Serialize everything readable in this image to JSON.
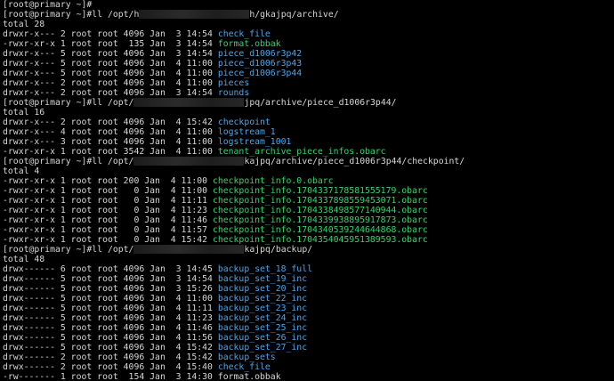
{
  "lines": [
    {
      "kind": "prompt",
      "text": "[root@primary ~]#"
    },
    {
      "kind": "prompt_path",
      "before": "[root@primary ~]#ll /opt/h",
      "after": "h/gkajpq/archive/"
    },
    {
      "kind": "plain",
      "text": "total 28"
    },
    {
      "kind": "entry",
      "meta": "drwxr-x--- 2 root root 4096 Jan  3 14:54 ",
      "name": "check_file",
      "style": "dir"
    },
    {
      "kind": "entry",
      "meta": "-rwxr-xr-x 1 root root  135 Jan  3 14:54 ",
      "name": "format.obbak",
      "style": "exe"
    },
    {
      "kind": "entry",
      "meta": "drwxr-x--- 5 root root 4096 Jan  3 14:54 ",
      "name": "piece_d1006r3p42",
      "style": "dir"
    },
    {
      "kind": "entry",
      "meta": "drwxr-x--- 5 root root 4096 Jan  4 11:00 ",
      "name": "piece_d1006r3p43",
      "style": "dir"
    },
    {
      "kind": "entry",
      "meta": "drwxr-x--- 5 root root 4096 Jan  4 11:00 ",
      "name": "piece_d1006r3p44",
      "style": "dir"
    },
    {
      "kind": "entry",
      "meta": "drwxr-x--- 2 root root 4096 Jan  4 11:00 ",
      "name": "pieces",
      "style": "dir"
    },
    {
      "kind": "entry",
      "meta": "drwxr-x--- 2 root root 4096 Jan  3 14:54 ",
      "name": "rounds",
      "style": "dir"
    },
    {
      "kind": "prompt_path",
      "before": "[root@primary ~]#ll /opt/",
      "after": "jpq/archive/piece_d1006r3p44/"
    },
    {
      "kind": "plain",
      "text": "total 16"
    },
    {
      "kind": "entry",
      "meta": "drwxr-x--- 2 root root 4096 Jan  4 15:42 ",
      "name": "checkpoint",
      "style": "dir"
    },
    {
      "kind": "entry",
      "meta": "drwxr-x--- 4 root root 4096 Jan  4 11:00 ",
      "name": "logstream_1",
      "style": "dir"
    },
    {
      "kind": "entry",
      "meta": "drwxr-x--- 3 root root 4096 Jan  4 11:00 ",
      "name": "logstream_1001",
      "style": "dir"
    },
    {
      "kind": "entry",
      "meta": "-rwxr-xr-x 1 root root 3542 Jan  4 11:00 ",
      "name": "tenant_archive_piece_infos.obarc",
      "style": "exe"
    },
    {
      "kind": "prompt_path",
      "before": "[root@primary ~]#ll /opt/",
      "after": "kajpq/archive/piece_d1006r3p44/checkpoint/"
    },
    {
      "kind": "plain",
      "text": "total 4"
    },
    {
      "kind": "entry",
      "meta": "-rwxr-xr-x 1 root root 200 Jan  4 11:00 ",
      "name": "checkpoint_info.0.obarc",
      "style": "exe"
    },
    {
      "kind": "entry",
      "meta": "-rwxr-xr-x 1 root root   0 Jan  4 11:00 ",
      "name": "checkpoint_info.1704337178581555179.obarc",
      "style": "exe"
    },
    {
      "kind": "entry",
      "meta": "-rwxr-xr-x 1 root root   0 Jan  4 11:11 ",
      "name": "checkpoint_info.1704337898559453071.obarc",
      "style": "exe"
    },
    {
      "kind": "entry",
      "meta": "-rwxr-xr-x 1 root root   0 Jan  4 11:23 ",
      "name": "checkpoint_info.1704338498577140944.obarc",
      "style": "exe"
    },
    {
      "kind": "entry",
      "meta": "-rwxr-xr-x 1 root root   0 Jan  4 11:46 ",
      "name": "checkpoint_info.1704339938895917873.obarc",
      "style": "exe"
    },
    {
      "kind": "entry",
      "meta": "-rwxr-xr-x 1 root root   0 Jan  4 11:57 ",
      "name": "checkpoint_info.1704340539244644868.obarc",
      "style": "exe"
    },
    {
      "kind": "entry",
      "meta": "-rwxr-xr-x 1 root root   0 Jan  4 15:42 ",
      "name": "checkpoint_info.1704354045951389593.obarc",
      "style": "exe"
    },
    {
      "kind": "prompt_path",
      "before": "[root@primary ~]#ll /opt/",
      "after": "kajpq/backup/"
    },
    {
      "kind": "plain",
      "text": "total 48"
    },
    {
      "kind": "entry",
      "meta": "drwx------ 6 root root 4096 Jan  3 14:45 ",
      "name": "backup_set_18_full",
      "style": "dir"
    },
    {
      "kind": "entry",
      "meta": "drwx------ 5 root root 4096 Jan  3 14:54 ",
      "name": "backup_set_19_inc",
      "style": "dir"
    },
    {
      "kind": "entry",
      "meta": "drwx------ 5 root root 4096 Jan  3 15:26 ",
      "name": "backup_set_20_inc",
      "style": "dir"
    },
    {
      "kind": "entry",
      "meta": "drwx------ 5 root root 4096 Jan  4 11:00 ",
      "name": "backup_set_22_inc",
      "style": "dir"
    },
    {
      "kind": "entry",
      "meta": "drwx------ 5 root root 4096 Jan  4 11:11 ",
      "name": "backup_set_23_inc",
      "style": "dir"
    },
    {
      "kind": "entry",
      "meta": "drwx------ 5 root root 4096 Jan  4 11:23 ",
      "name": "backup_set_24_inc",
      "style": "dir"
    },
    {
      "kind": "entry",
      "meta": "drwx------ 5 root root 4096 Jan  4 11:46 ",
      "name": "backup_set_25_inc",
      "style": "dir"
    },
    {
      "kind": "entry",
      "meta": "drwx------ 5 root root 4096 Jan  4 11:56 ",
      "name": "backup_set_26_inc",
      "style": "dir"
    },
    {
      "kind": "entry",
      "meta": "drwx------ 5 root root 4096 Jan  4 15:42 ",
      "name": "backup_set_27_inc",
      "style": "dir"
    },
    {
      "kind": "entry",
      "meta": "drwx------ 2 root root 4096 Jan  4 15:42 ",
      "name": "backup_sets",
      "style": "dir"
    },
    {
      "kind": "entry",
      "meta": "drwx------ 2 root root 4096 Jan  4 15:40 ",
      "name": "check_file",
      "style": "dir"
    },
    {
      "kind": "entry",
      "meta": "-rw------- 1 root root  154 Jan  3 14:30 ",
      "name": "format.obbak",
      "style": "plain"
    },
    {
      "kind": "prompt_path",
      "before": "[root@primary ~]#ll /opt/",
      "after": ""
    }
  ],
  "colors": {
    "background": "#000000",
    "text": "#d6d6d6",
    "directory": "#4fa4e8",
    "executable": "#35d46b"
  }
}
